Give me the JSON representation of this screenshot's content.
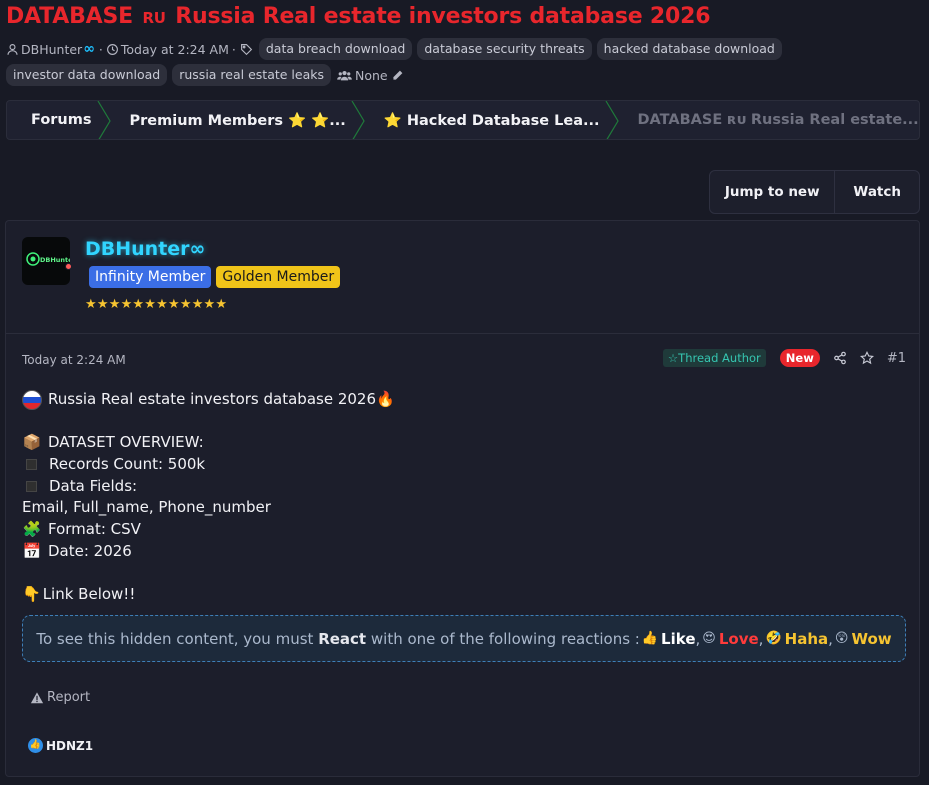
{
  "thread": {
    "title_prefix": "DATABASE",
    "title_flag": "RU",
    "title_text": "Russia Real estate investors database 2026"
  },
  "meta": {
    "author": "DBHunter",
    "author_suffix": "∞",
    "time": "Today at 2:24 AM",
    "tags": [
      "data breach download",
      "database security threats",
      "hacked database download",
      "investor data download",
      "russia real estate leaks"
    ],
    "participants": "None"
  },
  "breadcrumb": {
    "items": [
      "Forums",
      "Premium Members ⭐ ⭐...",
      "⭐ Hacked Database Lea...",
      "DATABASE ʀᴜ Russia Real estate..."
    ]
  },
  "toolbar": {
    "jump_label": "Jump to new",
    "watch_label": "Watch"
  },
  "post": {
    "username": "DBHunter",
    "username_suffix": "∞",
    "avatar_text": "DBHunter",
    "badges": [
      "Infinity Member",
      "Golden Member"
    ],
    "stars": "★★★★★★★★★★★★",
    "time": "Today at 2:24 AM",
    "thread_author": "Thread Author",
    "new_label": "New",
    "post_number": "#1",
    "content": {
      "line1": "Russia Real estate investors database 2026",
      "overview": "DATASET OVERVIEW:",
      "records": "Records Count: 500k",
      "fields": "Data Fields:",
      "fields_list": "Email, Full_name, Phone_number",
      "format": "Format: CSV",
      "date": "Date: 2026",
      "link": "Link Below!!"
    },
    "hidden": {
      "prefix": "To see this hidden content, you must",
      "react": "React",
      "middle": "with one of the following reactions :",
      "like": "Like",
      "love": "Love",
      "haha": "Haha",
      "wow": "Wow"
    },
    "report_label": "Report",
    "reaction_user": "HDNZ1"
  },
  "colors": {
    "accent_red": "#e8262c",
    "username_cyan": "#31d5ff",
    "infinity_badge": "#3b6ee6",
    "golden_badge": "#f0c419"
  }
}
